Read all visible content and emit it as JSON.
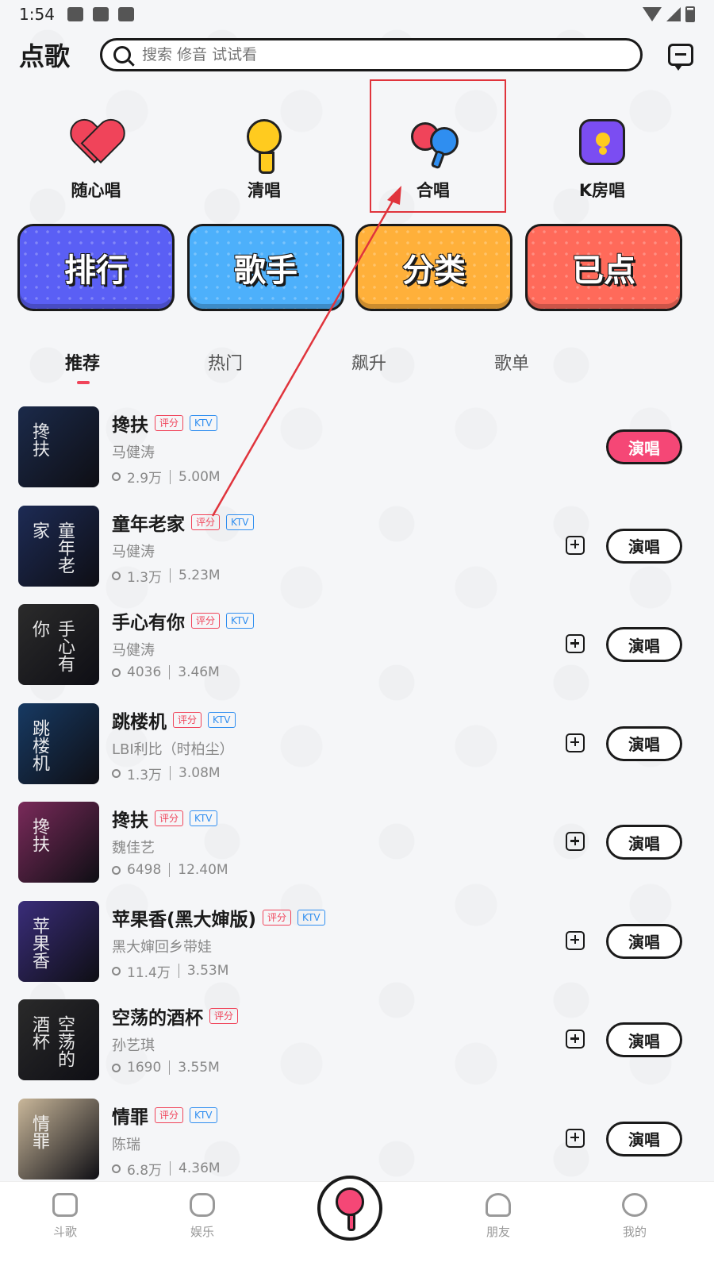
{
  "status_bar": {
    "time": "1:54"
  },
  "header": {
    "title": "点歌",
    "search_placeholder": "搜索 修音 试试看"
  },
  "modes": [
    {
      "label": "随心唱",
      "icon": "heart-mic-icon"
    },
    {
      "label": "清唱",
      "icon": "yellow-mic-icon"
    },
    {
      "label": "合唱",
      "icon": "duet-mic-icon"
    },
    {
      "label": "K房唱",
      "icon": "k-room-icon"
    }
  ],
  "categories": [
    {
      "label": "排行",
      "color": "#5a5ff5"
    },
    {
      "label": "歌手",
      "color": "#4db0fb"
    },
    {
      "label": "分类",
      "color": "#ffb03a"
    },
    {
      "label": "已点",
      "color": "#ff6a5a"
    }
  ],
  "tabs": [
    {
      "label": "推荐",
      "active": true
    },
    {
      "label": "热门",
      "active": false
    },
    {
      "label": "飙升",
      "active": false
    },
    {
      "label": "歌单",
      "active": false
    }
  ],
  "tag_labels": {
    "score": "评分",
    "ktv": "KTV"
  },
  "sing_label": "演唱",
  "songs": [
    {
      "title": "搀扶",
      "artist": "马健涛",
      "plays": "2.9万",
      "size": "5.00M",
      "score": true,
      "ktv": true,
      "add": false,
      "primary": true,
      "cover_text": "搀扶",
      "cover_color": "#1b2a4a"
    },
    {
      "title": "童年老家",
      "artist": "马健涛",
      "plays": "1.3万",
      "size": "5.23M",
      "score": true,
      "ktv": true,
      "add": true,
      "primary": false,
      "cover_text": "童年老家",
      "cover_color": "#1d2b55"
    },
    {
      "title": "手心有你",
      "artist": "马健涛",
      "plays": "4036",
      "size": "3.46M",
      "score": true,
      "ktv": true,
      "add": true,
      "primary": false,
      "cover_text": "手心有你",
      "cover_color": "#2b2b2b"
    },
    {
      "title": "跳楼机",
      "artist": "LBI利比（时柏尘）",
      "plays": "1.3万",
      "size": "3.08M",
      "score": true,
      "ktv": true,
      "add": true,
      "primary": false,
      "cover_text": "跳楼机",
      "cover_color": "#173a63"
    },
    {
      "title": "搀扶",
      "artist": "魏佳艺",
      "plays": "6498",
      "size": "12.40M",
      "score": true,
      "ktv": true,
      "add": true,
      "primary": false,
      "cover_text": "搀扶",
      "cover_color": "#7a2a5a"
    },
    {
      "title": "苹果香(黑大婶版)",
      "artist": "黑大婶回乡带娃",
      "plays": "11.4万",
      "size": "3.53M",
      "score": true,
      "ktv": true,
      "add": true,
      "primary": false,
      "cover_text": "苹果香",
      "cover_color": "#3a2d7a"
    },
    {
      "title": "空荡的酒杯",
      "artist": "孙艺琪",
      "plays": "1690",
      "size": "3.55M",
      "score": true,
      "ktv": false,
      "add": true,
      "primary": false,
      "cover_text": "空荡的酒杯",
      "cover_color": "#2a2a2a"
    },
    {
      "title": "情罪",
      "artist": "陈瑞",
      "plays": "6.8万",
      "size": "4.36M",
      "score": true,
      "ktv": true,
      "add": true,
      "primary": false,
      "cover_text": "情罪",
      "cover_color": "#c9b79a"
    }
  ],
  "bottom_nav": [
    {
      "label": "斗歌",
      "icon": "home-icon"
    },
    {
      "label": "娱乐",
      "icon": "gamepad-icon"
    },
    {
      "label": "朋友",
      "icon": "friends-icon"
    },
    {
      "label": "我的",
      "icon": "profile-icon"
    }
  ],
  "colors": {
    "accent": "#f54776",
    "annotation": "#e0343c",
    "tag_score": "#f0445a",
    "tag_ktv": "#2f8ef0"
  }
}
